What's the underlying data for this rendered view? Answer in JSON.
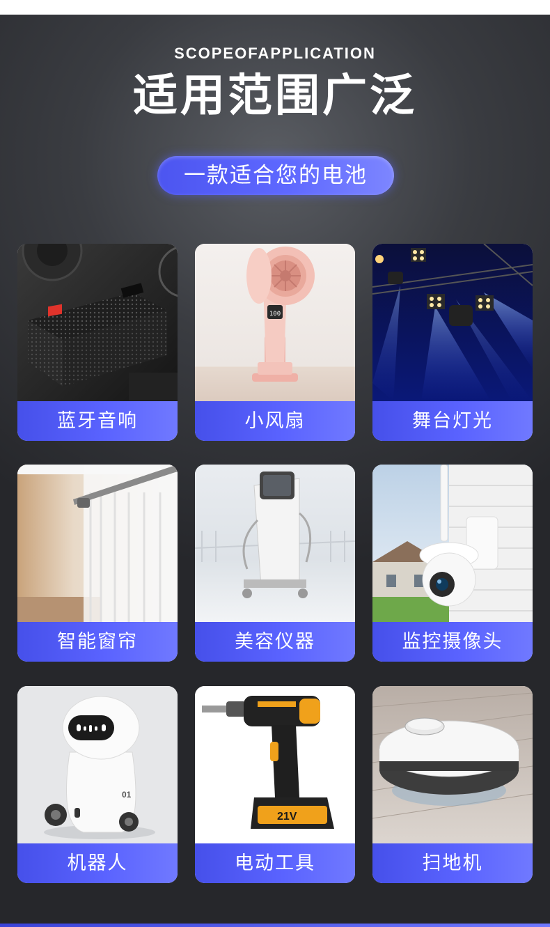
{
  "header": {
    "eyebrow": "SCOPEOFAPPLICATION",
    "title": "适用范围广泛",
    "pill": "一款适合您的电池"
  },
  "colors": {
    "background": "#2f3035",
    "accent": "#5a63ff"
  },
  "cards": [
    {
      "label": "蓝牙音响",
      "icon": "bluetooth-speaker-image"
    },
    {
      "label": "小风扇",
      "icon": "handheld-fan-image"
    },
    {
      "label": "舞台灯光",
      "icon": "stage-lights-image"
    },
    {
      "label": "智能窗帘",
      "icon": "smart-curtain-image"
    },
    {
      "label": "美容仪器",
      "icon": "beauty-device-image"
    },
    {
      "label": "监控摄像头",
      "icon": "security-camera-image"
    },
    {
      "label": "机器人",
      "icon": "robot-image"
    },
    {
      "label": "电动工具",
      "icon": "power-drill-image"
    },
    {
      "label": "扫地机",
      "icon": "robot-vacuum-image"
    }
  ],
  "drill_battery_text": "21V"
}
